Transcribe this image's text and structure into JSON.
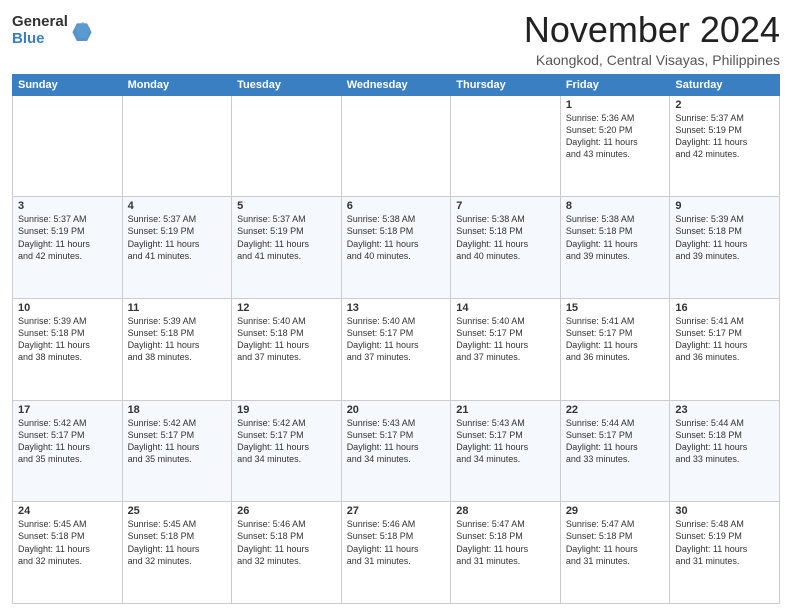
{
  "logo": {
    "general": "General",
    "blue": "Blue"
  },
  "header": {
    "month": "November 2024",
    "location": "Kaongkod, Central Visayas, Philippines"
  },
  "weekdays": [
    "Sunday",
    "Monday",
    "Tuesday",
    "Wednesday",
    "Thursday",
    "Friday",
    "Saturday"
  ],
  "weeks": [
    [
      {
        "day": "",
        "info": ""
      },
      {
        "day": "",
        "info": ""
      },
      {
        "day": "",
        "info": ""
      },
      {
        "day": "",
        "info": ""
      },
      {
        "day": "",
        "info": ""
      },
      {
        "day": "1",
        "info": "Sunrise: 5:36 AM\nSunset: 5:20 PM\nDaylight: 11 hours\nand 43 minutes."
      },
      {
        "day": "2",
        "info": "Sunrise: 5:37 AM\nSunset: 5:19 PM\nDaylight: 11 hours\nand 42 minutes."
      }
    ],
    [
      {
        "day": "3",
        "info": "Sunrise: 5:37 AM\nSunset: 5:19 PM\nDaylight: 11 hours\nand 42 minutes."
      },
      {
        "day": "4",
        "info": "Sunrise: 5:37 AM\nSunset: 5:19 PM\nDaylight: 11 hours\nand 41 minutes."
      },
      {
        "day": "5",
        "info": "Sunrise: 5:37 AM\nSunset: 5:19 PM\nDaylight: 11 hours\nand 41 minutes."
      },
      {
        "day": "6",
        "info": "Sunrise: 5:38 AM\nSunset: 5:18 PM\nDaylight: 11 hours\nand 40 minutes."
      },
      {
        "day": "7",
        "info": "Sunrise: 5:38 AM\nSunset: 5:18 PM\nDaylight: 11 hours\nand 40 minutes."
      },
      {
        "day": "8",
        "info": "Sunrise: 5:38 AM\nSunset: 5:18 PM\nDaylight: 11 hours\nand 39 minutes."
      },
      {
        "day": "9",
        "info": "Sunrise: 5:39 AM\nSunset: 5:18 PM\nDaylight: 11 hours\nand 39 minutes."
      }
    ],
    [
      {
        "day": "10",
        "info": "Sunrise: 5:39 AM\nSunset: 5:18 PM\nDaylight: 11 hours\nand 38 minutes."
      },
      {
        "day": "11",
        "info": "Sunrise: 5:39 AM\nSunset: 5:18 PM\nDaylight: 11 hours\nand 38 minutes."
      },
      {
        "day": "12",
        "info": "Sunrise: 5:40 AM\nSunset: 5:18 PM\nDaylight: 11 hours\nand 37 minutes."
      },
      {
        "day": "13",
        "info": "Sunrise: 5:40 AM\nSunset: 5:17 PM\nDaylight: 11 hours\nand 37 minutes."
      },
      {
        "day": "14",
        "info": "Sunrise: 5:40 AM\nSunset: 5:17 PM\nDaylight: 11 hours\nand 37 minutes."
      },
      {
        "day": "15",
        "info": "Sunrise: 5:41 AM\nSunset: 5:17 PM\nDaylight: 11 hours\nand 36 minutes."
      },
      {
        "day": "16",
        "info": "Sunrise: 5:41 AM\nSunset: 5:17 PM\nDaylight: 11 hours\nand 36 minutes."
      }
    ],
    [
      {
        "day": "17",
        "info": "Sunrise: 5:42 AM\nSunset: 5:17 PM\nDaylight: 11 hours\nand 35 minutes."
      },
      {
        "day": "18",
        "info": "Sunrise: 5:42 AM\nSunset: 5:17 PM\nDaylight: 11 hours\nand 35 minutes."
      },
      {
        "day": "19",
        "info": "Sunrise: 5:42 AM\nSunset: 5:17 PM\nDaylight: 11 hours\nand 34 minutes."
      },
      {
        "day": "20",
        "info": "Sunrise: 5:43 AM\nSunset: 5:17 PM\nDaylight: 11 hours\nand 34 minutes."
      },
      {
        "day": "21",
        "info": "Sunrise: 5:43 AM\nSunset: 5:17 PM\nDaylight: 11 hours\nand 34 minutes."
      },
      {
        "day": "22",
        "info": "Sunrise: 5:44 AM\nSunset: 5:17 PM\nDaylight: 11 hours\nand 33 minutes."
      },
      {
        "day": "23",
        "info": "Sunrise: 5:44 AM\nSunset: 5:18 PM\nDaylight: 11 hours\nand 33 minutes."
      }
    ],
    [
      {
        "day": "24",
        "info": "Sunrise: 5:45 AM\nSunset: 5:18 PM\nDaylight: 11 hours\nand 32 minutes."
      },
      {
        "day": "25",
        "info": "Sunrise: 5:45 AM\nSunset: 5:18 PM\nDaylight: 11 hours\nand 32 minutes."
      },
      {
        "day": "26",
        "info": "Sunrise: 5:46 AM\nSunset: 5:18 PM\nDaylight: 11 hours\nand 32 minutes."
      },
      {
        "day": "27",
        "info": "Sunrise: 5:46 AM\nSunset: 5:18 PM\nDaylight: 11 hours\nand 31 minutes."
      },
      {
        "day": "28",
        "info": "Sunrise: 5:47 AM\nSunset: 5:18 PM\nDaylight: 11 hours\nand 31 minutes."
      },
      {
        "day": "29",
        "info": "Sunrise: 5:47 AM\nSunset: 5:18 PM\nDaylight: 11 hours\nand 31 minutes."
      },
      {
        "day": "30",
        "info": "Sunrise: 5:48 AM\nSunset: 5:19 PM\nDaylight: 11 hours\nand 31 minutes."
      }
    ]
  ]
}
